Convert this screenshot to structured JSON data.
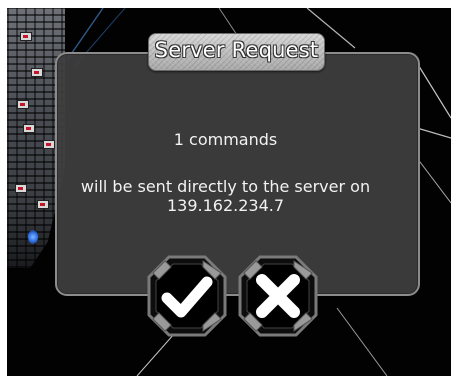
{
  "dialog": {
    "title": "Server Request",
    "count_text": "1 commands",
    "line1": "will be sent directly to the server on",
    "line2": "139.162.234.7"
  },
  "buttons": {
    "confirm_icon": "checkmark-icon",
    "cancel_icon": "x-icon"
  },
  "colors": {
    "background": "#020203",
    "dialog_fill": "#3e3e40",
    "dialog_border": "#8c8c8c",
    "text": "#ffffff",
    "plate": "#bdbdbd"
  }
}
